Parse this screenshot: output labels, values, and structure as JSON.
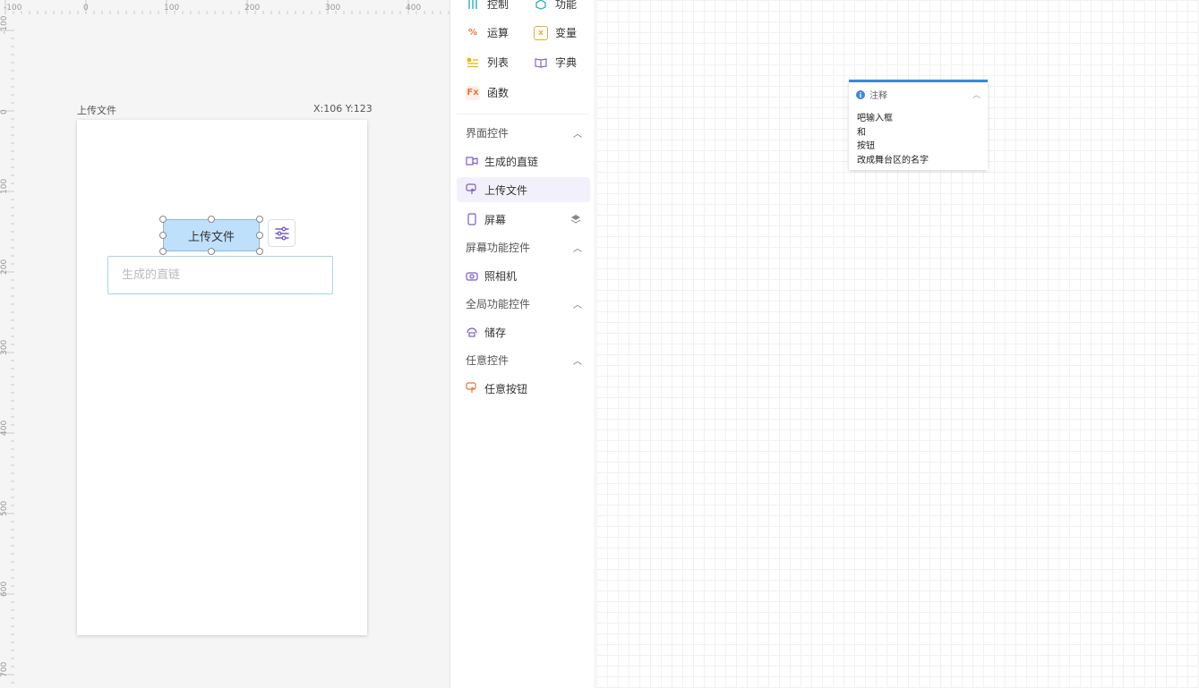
{
  "stage": {
    "ruler_top": [
      "-100",
      "0",
      "100",
      "200",
      "300",
      "400"
    ],
    "ruler_left": [
      "-100",
      "0",
      "100",
      "200",
      "300",
      "400",
      "500",
      "600",
      "700"
    ],
    "screen_title": "上传文件",
    "coords": "X:106 Y:123",
    "upload_button_label": "上传文件",
    "link_input_placeholder": "生成的直链"
  },
  "panel": {
    "categories": [
      {
        "label": "控制",
        "icon": "sliders-icon",
        "color": "#1aa3c8"
      },
      {
        "label": "功能",
        "icon": "function-icon",
        "color": "#1aa3c8"
      },
      {
        "label": "运算",
        "icon": "operator-icon",
        "color": "#e8743b"
      },
      {
        "label": "变量",
        "icon": "variable-icon",
        "color": "#f0a830"
      },
      {
        "label": "列表",
        "icon": "list-icon",
        "color": "#f0b400"
      },
      {
        "label": "字典",
        "icon": "dictionary-icon",
        "color": "#8a63d2"
      },
      {
        "label": "函数",
        "icon": "fx-icon",
        "color": "#e8743b",
        "glyph": "Fx"
      }
    ],
    "sections": [
      {
        "title": "界面控件",
        "items": [
          {
            "label": "生成的直链",
            "icon": "input-icon"
          },
          {
            "label": "上传文件",
            "icon": "button-icon",
            "selected": true
          },
          {
            "label": "屏幕",
            "icon": "phone-icon",
            "extra": "layers-icon"
          }
        ]
      },
      {
        "title": "屏幕功能控件",
        "items": [
          {
            "label": "照相机",
            "icon": "camera-icon"
          }
        ]
      },
      {
        "title": "全局功能控件",
        "items": [
          {
            "label": "储存",
            "icon": "storage-icon"
          }
        ]
      },
      {
        "title": "任意控件",
        "items": [
          {
            "label": "任意按钮",
            "icon": "any-button-icon"
          }
        ]
      }
    ]
  },
  "comment": {
    "title": "注释",
    "lines": [
      "吧输入框",
      "和",
      "按钮",
      "改成舞台区的名字"
    ],
    "accent_color": "#3d86e0"
  }
}
